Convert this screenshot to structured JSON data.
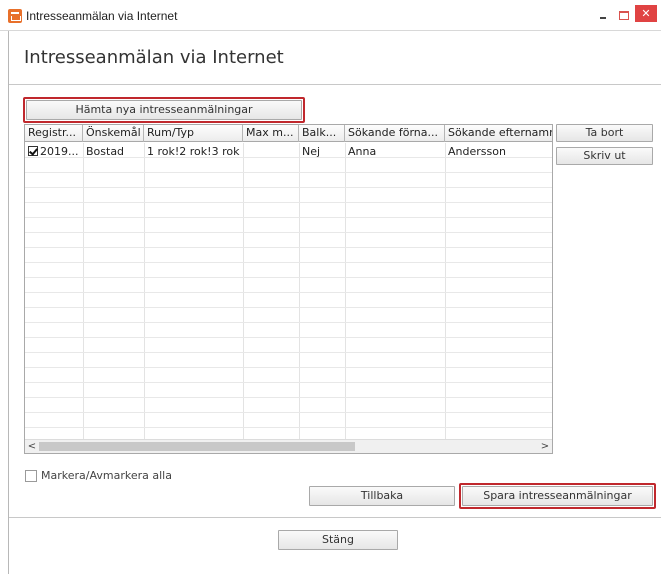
{
  "window": {
    "title": "Intresseanmälan via Internet",
    "minimize_glyph": "–",
    "maximize_glyph": "□",
    "close_glyph": "✕"
  },
  "page": {
    "title": "Intresseanmälan via Internet"
  },
  "actions": {
    "fetch_label": "Hämta nya intresseanmälningar",
    "delete_label": "Ta bort",
    "print_label": "Skriv ut",
    "back_label": "Tillbaka",
    "save_label": "Spara intresseanmälningar",
    "close_label": "Stäng"
  },
  "grid": {
    "columns": [
      "Registr...",
      "Önskemål",
      "Rum/Typ",
      "Max m...",
      "Balk...",
      "Sökande förna...",
      "Sökande efternamn"
    ],
    "rows": [
      {
        "checked": true,
        "cells": [
          "2019...",
          "Bostad",
          "1 rok!2 rok!3 rok",
          "",
          "Nej",
          "Anna",
          "Andersson"
        ]
      }
    ],
    "scroll_left_glyph": "<",
    "scroll_right_glyph": ">"
  },
  "select_all": {
    "label": "Markera/Avmarkera alla",
    "checked": false
  },
  "icons": {
    "app": "app-icon",
    "minimize": "minimize-icon",
    "maximize": "maximize-icon",
    "close": "close-icon",
    "checkbox": "checkbox-checked-icon"
  },
  "colors": {
    "highlight": "#c0282d",
    "close_button": "#e04343",
    "app_icon": "#e8702a"
  }
}
